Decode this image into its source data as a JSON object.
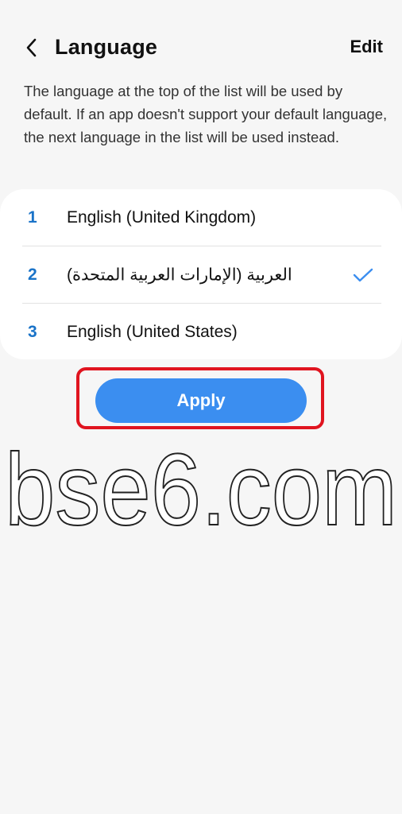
{
  "header": {
    "title": "Language",
    "edit_label": "Edit",
    "back_icon": "chevron-left-icon"
  },
  "description": "The language at the top of the list will be used by default. If an app doesn't support your default language, the next language in the list will be used instead.",
  "languages": [
    {
      "number": "1",
      "name": "English (United Kingdom)",
      "checked": false
    },
    {
      "number": "2",
      "name": "العربية (الإمارات العربية المتحدة)",
      "checked": true
    },
    {
      "number": "3",
      "name": "English (United States)",
      "checked": false
    }
  ],
  "apply_label": "Apply",
  "watermark": "bse6.com",
  "colors": {
    "accent": "#3b8ef0",
    "number": "#1a73c8",
    "highlight": "#e0141f",
    "background": "#f6f6f6"
  }
}
